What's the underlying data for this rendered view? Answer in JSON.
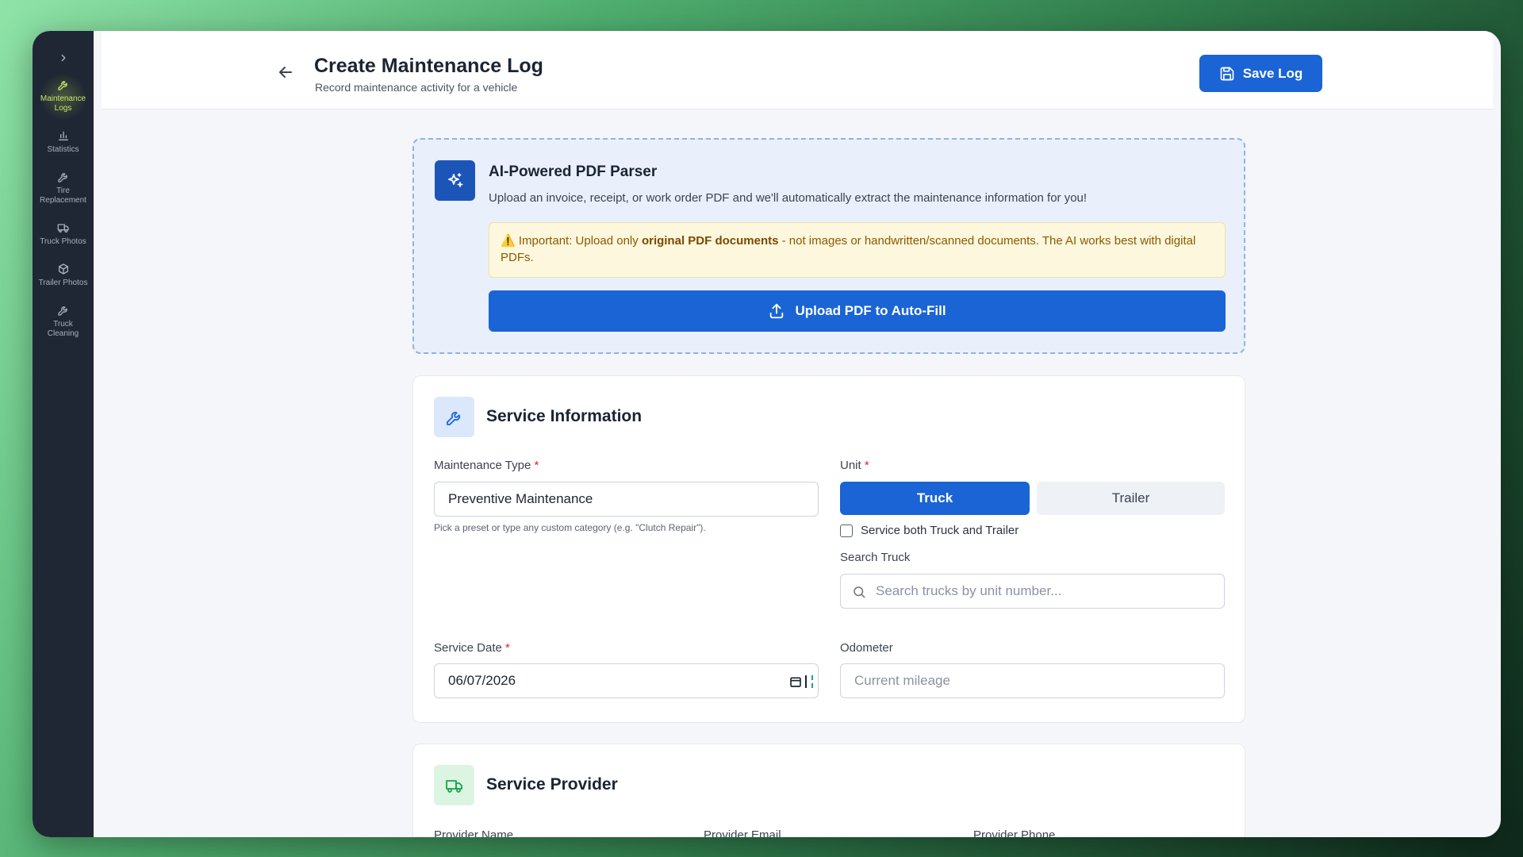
{
  "sidebar": {
    "items": [
      {
        "label": "Maintenance Logs",
        "icon": "wrench-icon",
        "active": true
      },
      {
        "label": "Statistics",
        "icon": "bar-chart-icon",
        "active": false
      },
      {
        "label": "Tire Replacement",
        "icon": "wrench-icon",
        "active": false
      },
      {
        "label": "Truck Photos",
        "icon": "truck-icon",
        "active": false
      },
      {
        "label": "Trailer Photos",
        "icon": "package-icon",
        "active": false
      },
      {
        "label": "Truck Cleaning",
        "icon": "wrench-icon",
        "active": false
      }
    ]
  },
  "header": {
    "title": "Create Maintenance Log",
    "subtitle": "Record maintenance activity for a vehicle",
    "save_label": "Save Log"
  },
  "ai_parser": {
    "title": "AI-Powered PDF Parser",
    "description": "Upload an invoice, receipt, or work order PDF and we'll automatically extract the maintenance information for you!",
    "warning_prefix": "⚠️ Important: Upload only ",
    "warning_bold": "original PDF documents",
    "warning_suffix": " - not images or handwritten/scanned documents. The AI works best with digital PDFs.",
    "upload_label": "Upload PDF to Auto-Fill"
  },
  "service_info": {
    "title": "Service Information",
    "maintenance_type_label": "Maintenance Type",
    "maintenance_type_value": "Preventive Maintenance",
    "maintenance_type_hint": "Pick a preset or type any custom category (e.g. \"Clutch Repair\").",
    "unit_label": "Unit",
    "unit_options": [
      "Truck",
      "Trailer"
    ],
    "unit_selected": "Truck",
    "both_label": "Service both Truck and Trailer",
    "search_label": "Search Truck",
    "search_placeholder": "Search trucks by unit number...",
    "service_date_label": "Service Date",
    "service_date_value": "06/07/2026",
    "odometer_label": "Odometer",
    "odometer_placeholder": "Current mileage",
    "required_mark": "*"
  },
  "service_provider": {
    "title": "Service Provider",
    "provider_name_label": "Provider Name",
    "provider_email_label": "Provider Email",
    "provider_phone_label": "Provider Phone"
  },
  "colors": {
    "primary": "#1a64d6",
    "sidebar_bg": "#1f2734",
    "active_nav": "#c8e66b"
  }
}
